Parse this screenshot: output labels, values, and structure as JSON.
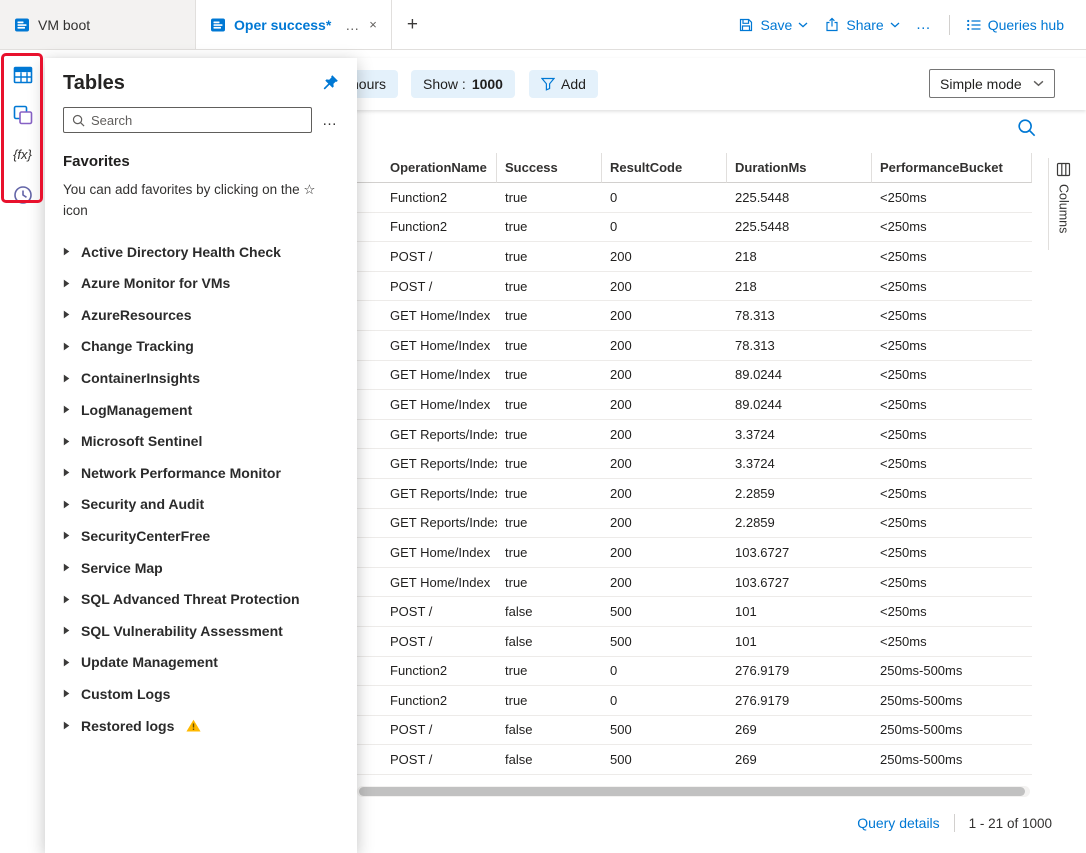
{
  "colors": {
    "accent": "#0078d4",
    "annotation_red": "#e8112d",
    "warning": "#ffb900",
    "pill_bg": "#e4f1fb"
  },
  "glyphs": {
    "more": "…",
    "close": "×",
    "plus": "+",
    "functions": "{fx}"
  },
  "topbar": {
    "tabs": [
      {
        "label": "VM boot"
      },
      {
        "label": "Oper success*"
      }
    ],
    "save_label": "Save",
    "share_label": "Share",
    "queries_hub_label": "Queries hub"
  },
  "left_rail": {
    "icons": [
      "tables-icon",
      "queries-icon",
      "functions-icon",
      "query-history-icon"
    ]
  },
  "tables_panel": {
    "title": "Tables",
    "search": {
      "placeholder": "Search"
    },
    "favorites": {
      "title": "Favorites",
      "hint": "You can add favorites by clicking on the ☆ icon"
    },
    "groups": [
      {
        "label": "Active Directory Health Check"
      },
      {
        "label": "Azure Monitor for VMs"
      },
      {
        "label": "AzureResources"
      },
      {
        "label": "Change Tracking"
      },
      {
        "label": "ContainerInsights"
      },
      {
        "label": "LogManagement"
      },
      {
        "label": "Microsoft Sentinel"
      },
      {
        "label": "Network Performance Monitor"
      },
      {
        "label": "Security and Audit"
      },
      {
        "label": "SecurityCenterFree"
      },
      {
        "label": "Service Map"
      },
      {
        "label": "SQL Advanced Threat Protection"
      },
      {
        "label": "SQL Vulnerability Assessment"
      },
      {
        "label": "Update Management"
      },
      {
        "label": "Custom Logs"
      },
      {
        "label": "Restored logs",
        "warning": true
      }
    ]
  },
  "toolbar": {
    "time_pill_label": "hours",
    "show_pill": {
      "label": "Show :",
      "value": "1000"
    },
    "add_pill_label": "Add",
    "mode_dropdown": {
      "value": "Simple mode"
    }
  },
  "results": {
    "columns": [
      "OperationName",
      "Success",
      "ResultCode",
      "DurationMs",
      "PerformanceBucket"
    ],
    "rows": [
      [
        "Function2",
        "true",
        "0",
        "225.5448",
        "<250ms"
      ],
      [
        "Function2",
        "true",
        "0",
        "225.5448",
        "<250ms"
      ],
      [
        "POST /",
        "true",
        "200",
        "218",
        "<250ms"
      ],
      [
        "POST /",
        "true",
        "200",
        "218",
        "<250ms"
      ],
      [
        "GET Home/Index",
        "true",
        "200",
        "78.313",
        "<250ms"
      ],
      [
        "GET Home/Index",
        "true",
        "200",
        "78.313",
        "<250ms"
      ],
      [
        "GET Home/Index",
        "true",
        "200",
        "89.0244",
        "<250ms"
      ],
      [
        "GET Home/Index",
        "true",
        "200",
        "89.0244",
        "<250ms"
      ],
      [
        "GET Reports/Index",
        "true",
        "200",
        "3.3724",
        "<250ms"
      ],
      [
        "GET Reports/Index",
        "true",
        "200",
        "3.3724",
        "<250ms"
      ],
      [
        "GET Reports/Index",
        "true",
        "200",
        "2.2859",
        "<250ms"
      ],
      [
        "GET Reports/Index",
        "true",
        "200",
        "2.2859",
        "<250ms"
      ],
      [
        "GET Home/Index",
        "true",
        "200",
        "103.6727",
        "<250ms"
      ],
      [
        "GET Home/Index",
        "true",
        "200",
        "103.6727",
        "<250ms"
      ],
      [
        "POST /",
        "false",
        "500",
        "101",
        "<250ms"
      ],
      [
        "POST /",
        "false",
        "500",
        "101",
        "<250ms"
      ],
      [
        "Function2",
        "true",
        "0",
        "276.9179",
        "250ms-500ms"
      ],
      [
        "Function2",
        "true",
        "0",
        "276.9179",
        "250ms-500ms"
      ],
      [
        "POST /",
        "false",
        "500",
        "269",
        "250ms-500ms"
      ],
      [
        "POST /",
        "false",
        "500",
        "269",
        "250ms-500ms"
      ]
    ],
    "side_pane_label": "Columns",
    "footer": {
      "query_details_label": "Query details",
      "range_label": "1 - 21 of 1000"
    }
  }
}
